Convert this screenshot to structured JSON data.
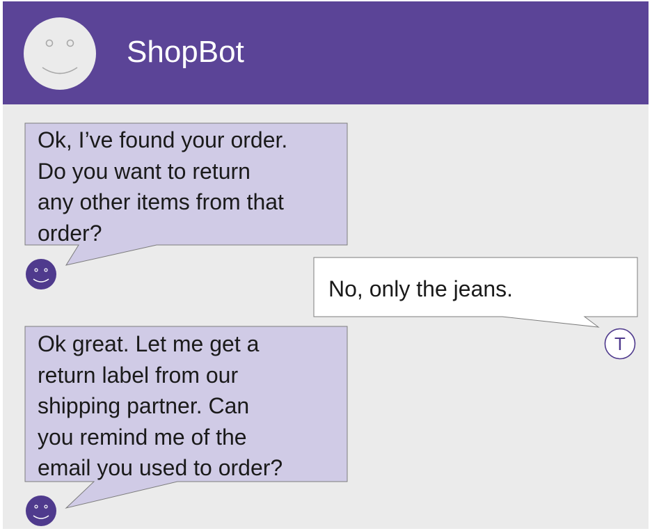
{
  "header": {
    "title": "ShopBot"
  },
  "messages": [
    {
      "sender": "bot",
      "text": "Ok, I’ve found your order.\nDo you want to return\nany other items from that\norder?"
    },
    {
      "sender": "user",
      "text": "No, only the jeans.",
      "avatar_initial": "T"
    },
    {
      "sender": "bot",
      "text": "Ok great. Let me get a\nreturn label from our\nshipping partner.  Can\nyou remind me of the\nemail you used to order?"
    }
  ],
  "colors": {
    "header_bg": "#5b4497",
    "bot_bubble": "#d0cbe6",
    "user_bubble": "#ffffff",
    "avatar_purple": "#4f3a8d",
    "background": "#ebebeb"
  }
}
